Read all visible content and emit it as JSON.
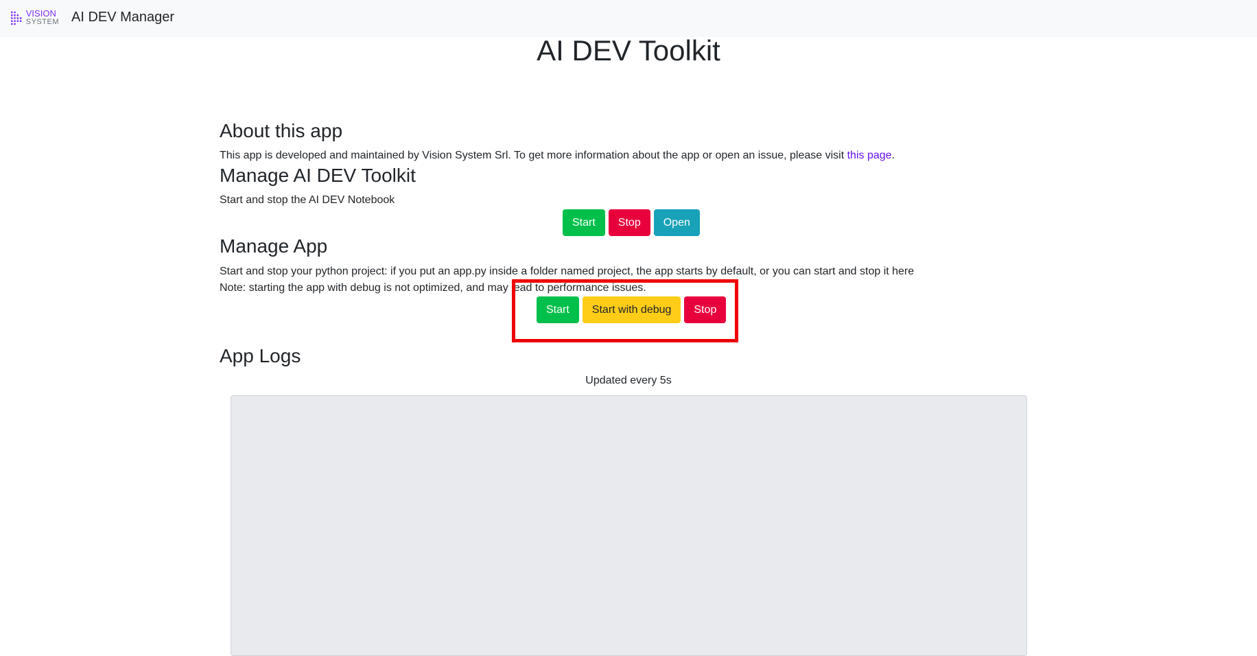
{
  "navbar": {
    "logo_line1": "VISION",
    "logo_line2": "SYSTEM",
    "title": "AI DEV Manager"
  },
  "page": {
    "title": "AI DEV Toolkit"
  },
  "about": {
    "heading": "About this app",
    "text_before_link": "This app is developed and maintained by Vision System Srl. To get more information about the app or open an issue, please visit ",
    "link_label": "this page",
    "text_after_link": "."
  },
  "toolkit": {
    "heading": "Manage AI DEV Toolkit",
    "description": "Start and stop the AI DEV Notebook",
    "buttons": {
      "start": "Start",
      "stop": "Stop",
      "open": "Open"
    }
  },
  "app": {
    "heading": "Manage App",
    "description": "Start and stop your python project: if you put an app.py inside a folder named project, the app starts by default, or you can start and stop it here",
    "note": "Note: starting the app with debug is not optimized, and may lead to performance issues.",
    "buttons": {
      "start": "Start",
      "start_debug": "Start with debug",
      "stop": "Stop"
    }
  },
  "logs": {
    "heading": "App Logs",
    "caption": "Updated every 5s",
    "content": ""
  },
  "colors": {
    "success": "#00c04b",
    "danger": "#e8003d",
    "info": "#17a2b8",
    "warning": "#ffcd18",
    "link": "#6610f2",
    "highlight": "#ee0000"
  }
}
